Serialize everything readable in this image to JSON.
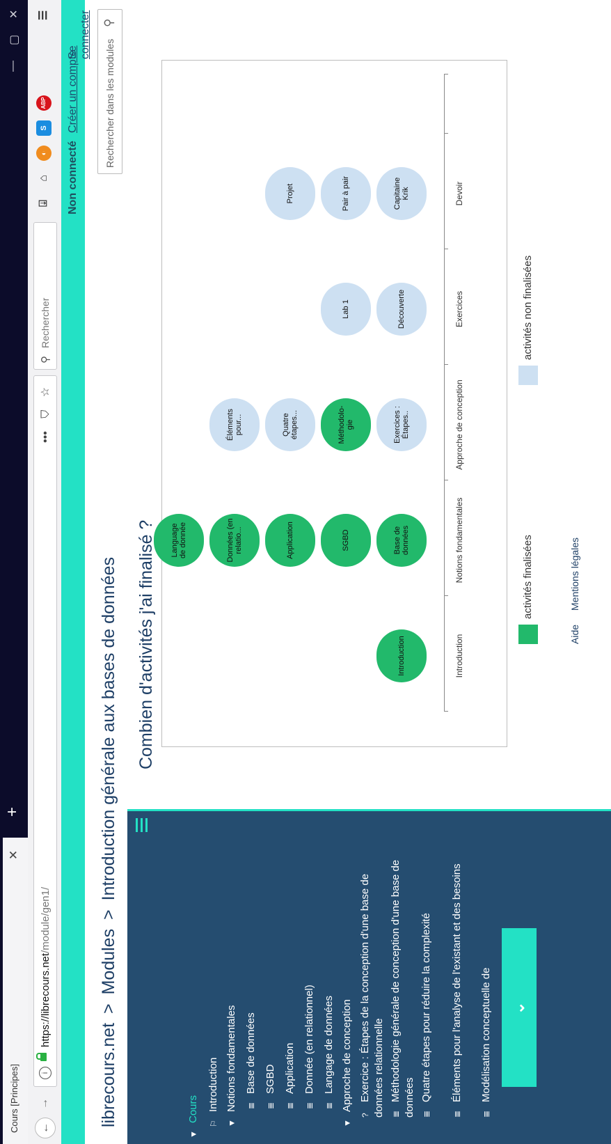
{
  "browser": {
    "tab_title": "Cours [Principes]",
    "url_host": "https://librecours.net",
    "url_path": "/module/gen1/",
    "search_placeholder": "Rechercher"
  },
  "topbar": {
    "status": "Non connecté",
    "create_account": "Créer un compte",
    "login": "Se connecter"
  },
  "breadcrumb": {
    "site": "librecours.net",
    "sep": ">",
    "modules": "Modules",
    "current": "Introduction générale aux bases de données"
  },
  "site_search": {
    "placeholder": "Rechercher dans les modules"
  },
  "sidebar": {
    "root": "Cours",
    "items": [
      {
        "label": "Introduction",
        "icon": "flag"
      },
      {
        "label": "Notions fondamentales",
        "icon": "chevron"
      },
      {
        "label": "Base de données",
        "icon": "list"
      },
      {
        "label": "SGBD",
        "icon": "list"
      },
      {
        "label": "Application",
        "icon": "list"
      },
      {
        "label": "Donnée (en relationnel)",
        "icon": "list"
      },
      {
        "label": "Langage de données",
        "icon": "list"
      },
      {
        "label": "Approche de conception",
        "icon": "chevron"
      },
      {
        "label": "Exercice : Étapes de la conception d'une base de données relationnelle",
        "icon": "question"
      },
      {
        "label": "Méthodologie générale de conception d'une base de données",
        "icon": "list"
      },
      {
        "label": "Quatre étapes pour réduire la complexité",
        "icon": "list"
      },
      {
        "label": "Éléments pour l'analyse de l'existant et des besoins",
        "icon": "list"
      },
      {
        "label": "Modélisation conceptuelle de",
        "icon": "list"
      }
    ]
  },
  "main": {
    "title": "Combien d'activités j'ai finalisé ?"
  },
  "chart_data": {
    "type": "table",
    "columns": [
      "Introduction",
      "Notions fondamentales",
      "Approche de conception",
      "Exercices",
      "Devoir"
    ],
    "activities": [
      {
        "column": "Introduction",
        "label": "Introduction",
        "done": true
      },
      {
        "column": "Notions fondamentales",
        "label": "Base de données",
        "done": true
      },
      {
        "column": "Notions fondamentales",
        "label": "SGBD",
        "done": true
      },
      {
        "column": "Notions fondamentales",
        "label": "Application",
        "done": true
      },
      {
        "column": "Notions fondamentales",
        "label": "Données (en relatio...",
        "done": true
      },
      {
        "column": "Notions fondamentales",
        "label": "Language de donnée",
        "done": true
      },
      {
        "column": "Approche de conception",
        "label": "Exercices : Étapes..",
        "done": false
      },
      {
        "column": "Approche de conception",
        "label": "Méthodolo-gie",
        "done": true
      },
      {
        "column": "Approche de conception",
        "label": "Quatre étapes...",
        "done": false
      },
      {
        "column": "Approche de conception",
        "label": "Éléments pour...",
        "done": false
      },
      {
        "column": "Exercices",
        "label": "Découverte",
        "done": false
      },
      {
        "column": "Exercices",
        "label": "Lab 1",
        "done": false
      },
      {
        "column": "Devoir",
        "label": "Capitaine Krik",
        "done": false
      },
      {
        "column": "Devoir",
        "label": "Pair à pair",
        "done": false
      },
      {
        "column": "Devoir",
        "label": "Projet",
        "done": false
      }
    ],
    "legend": [
      {
        "label": "activités finalisées",
        "color": "#22b96b"
      },
      {
        "label": "activités non finalisées",
        "color": "#cde0f2"
      }
    ]
  },
  "footer": {
    "help": "Aide",
    "legal": "Mentions légales"
  },
  "colors": {
    "teal": "#23e1c5",
    "navy": "#254d70",
    "done": "#22b96b",
    "todo": "#cde0f2"
  }
}
